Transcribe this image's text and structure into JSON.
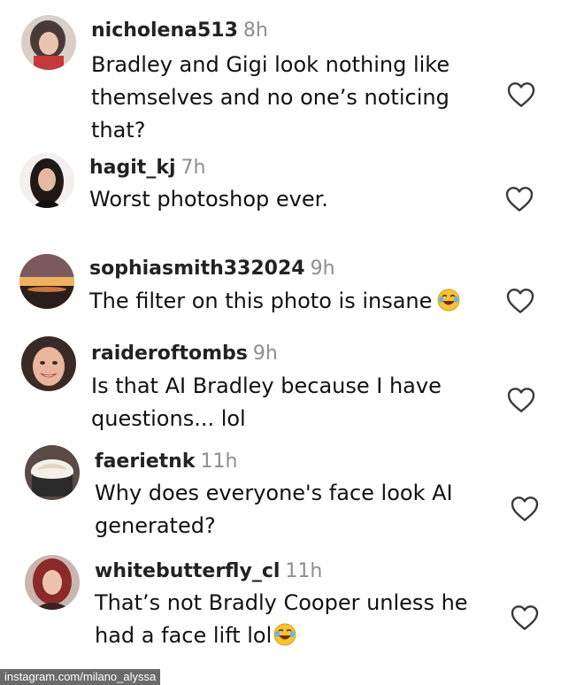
{
  "comments": [
    {
      "username": "nicholena513",
      "time": "8h",
      "lines": [
        "Bradley and Gigi look nothing like",
        "themselves and no one’s noticing",
        "that?"
      ],
      "avatar_icon": "profile-photo-woman-dark-hair"
    },
    {
      "username": "hagit_kj",
      "time": "7h",
      "lines": [
        "Worst photoshop ever."
      ],
      "avatar_icon": "profile-photo-woman-long-dark-hair"
    },
    {
      "username": "sophiasmith332024",
      "time": "9h",
      "lines": [
        "The filter on this photo is insane"
      ],
      "emoji": "face-with-tears-of-joy",
      "avatar_icon": "profile-photo-sunset-landscape"
    },
    {
      "username": "raideroftombs",
      "time": "9h",
      "lines": [
        "Is that AI Bradley because I have",
        "questions... lol"
      ],
      "avatar_icon": "profile-photo-smiling-woman"
    },
    {
      "username": "faerietnk",
      "time": "11h",
      "lines": [
        "Why does everyone's face look AI",
        "generated?"
      ],
      "avatar_icon": "profile-photo-coffee-cup"
    },
    {
      "username": "whitebutterfly_cl",
      "time": "11h",
      "lines": [
        "That’s not Bradly Cooper unless he",
        "had a face lift lol"
      ],
      "emoji": "face-with-tears-of-joy",
      "avatar_icon": "profile-photo-woman-red-hair"
    }
  ],
  "like_icon": "heart-outline-icon",
  "credit": "instagram.com/milano_alyssa",
  "colors": {
    "username": "#222222",
    "timestamp": "#8e8e8e",
    "text": "#111111",
    "heart": "#3a3a3a",
    "credit_bg": "#6a6a6a"
  }
}
